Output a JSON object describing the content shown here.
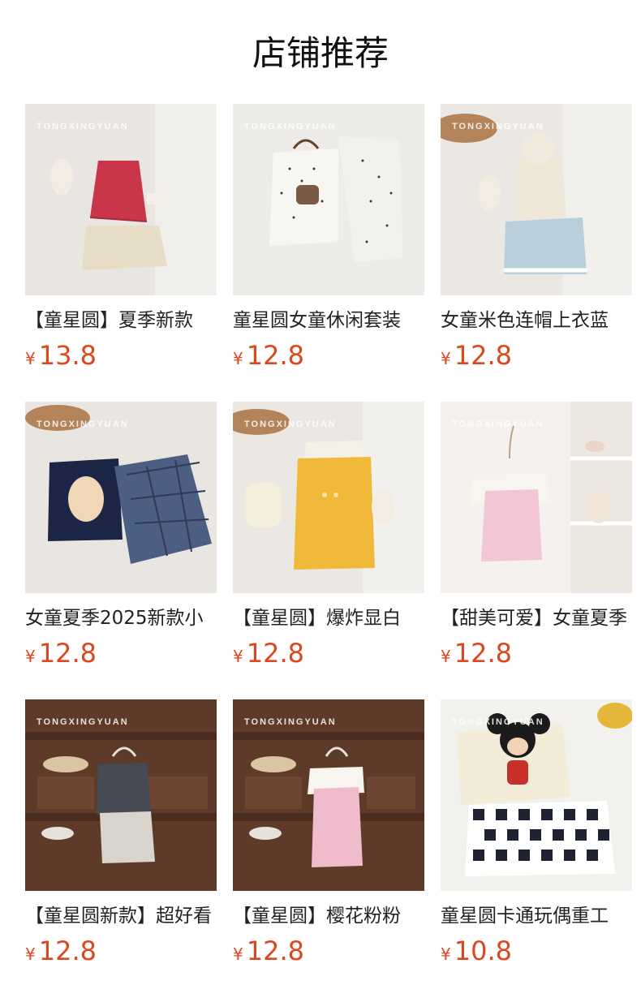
{
  "page": {
    "title": "店铺推荐"
  },
  "products": [
    {
      "name": "【童星圆】夏季新款",
      "currency": "¥",
      "price": "13.8",
      "watermark": "TONGXINGYUAN",
      "palette": [
        "#e9e6e2",
        "#c9364a",
        "#e7ddc7"
      ]
    },
    {
      "name": "童星圆女童休闲套装",
      "currency": "¥",
      "price": "12.8",
      "watermark": "TONGXINGYUAN",
      "palette": [
        "#eeece9",
        "#f4f3f0",
        "#3a3a3a"
      ]
    },
    {
      "name": "女童米色连帽上衣蓝",
      "currency": "¥",
      "price": "12.8",
      "watermark": "TONGXINGYUAN",
      "palette": [
        "#ebe8e3",
        "#efe7d8",
        "#b9d0dc"
      ]
    },
    {
      "name": "女童夏季2025新款小",
      "currency": "¥",
      "price": "12.8",
      "watermark": "TONGXINGYUAN",
      "palette": [
        "#e9e6e2",
        "#1d2547",
        "#4c5e82"
      ]
    },
    {
      "name": "【童星圆】爆炸显白",
      "currency": "¥",
      "price": "12.8",
      "watermark": "TONGXINGYUAN",
      "palette": [
        "#ebe8e4",
        "#f0b93a",
        "#f5f1e7"
      ]
    },
    {
      "name": "【甜美可爱】女童夏季",
      "currency": "¥",
      "price": "12.8",
      "watermark": "TONGXINGYUAN",
      "palette": [
        "#f4f1ee",
        "#f2c6d4",
        "#f8f4ee"
      ]
    },
    {
      "name": "【童星圆新款】超好看",
      "currency": "¥",
      "price": "12.8",
      "watermark": "TONGXINGYUAN",
      "palette": [
        "#5e3b28",
        "#454a54",
        "#d9d4cc"
      ]
    },
    {
      "name": "【童星圆】樱花粉粉",
      "currency": "¥",
      "price": "12.8",
      "watermark": "TONGXINGYUAN",
      "palette": [
        "#5e3b28",
        "#f0bccb",
        "#f8f4ee"
      ]
    },
    {
      "name": "童星圆卡通玩偶重工",
      "currency": "¥",
      "price": "10.8",
      "watermark": "TONGXINGYUAN",
      "palette": [
        "#f3f1ed",
        "#1e2233",
        "#f3ecd9"
      ]
    }
  ]
}
